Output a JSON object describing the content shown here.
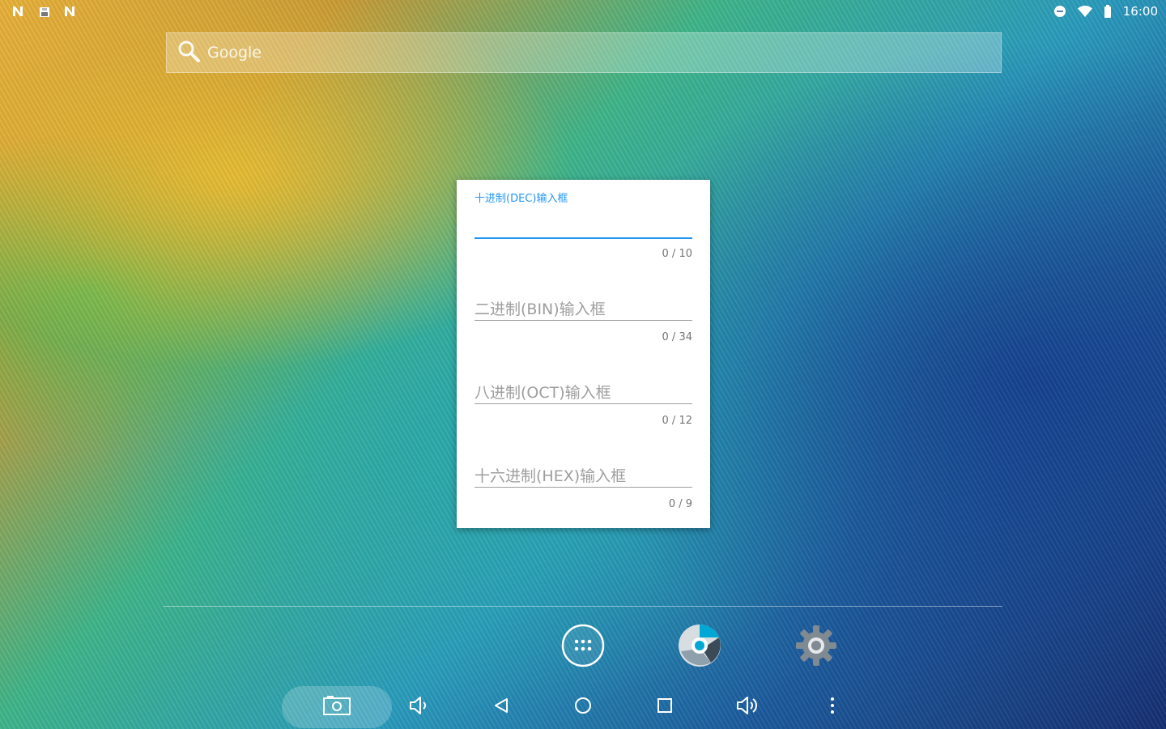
{
  "status_bar": {
    "notification_icons": [
      "n-notification-icon",
      "sd-card-icon",
      "n-notification-icon"
    ],
    "system_icons": [
      "dnd-icon",
      "wifi-icon",
      "battery-icon"
    ],
    "time": "16:00"
  },
  "search": {
    "placeholder": "Google",
    "icon": "search-icon"
  },
  "widget": {
    "fields": [
      {
        "label": "十进制(DEC)输入框",
        "counter": "0 / 10",
        "active": true
      },
      {
        "label": "二进制(BIN)输入框",
        "counter": "0 / 34",
        "active": false
      },
      {
        "label": "八进制(OCT)输入框",
        "counter": "0 / 12",
        "active": false
      },
      {
        "label": "十六进制(HEX)输入框",
        "counter": "0 / 9",
        "active": false
      }
    ],
    "accent_color": "#2196f3"
  },
  "dock": {
    "items": [
      "app-drawer-icon",
      "browser-icon",
      "settings-icon"
    ]
  },
  "nav_bar": {
    "buttons": [
      "screenshot-icon",
      "volume-down-icon",
      "back-icon",
      "home-icon",
      "recents-icon",
      "volume-up-icon",
      "more-icon"
    ]
  }
}
